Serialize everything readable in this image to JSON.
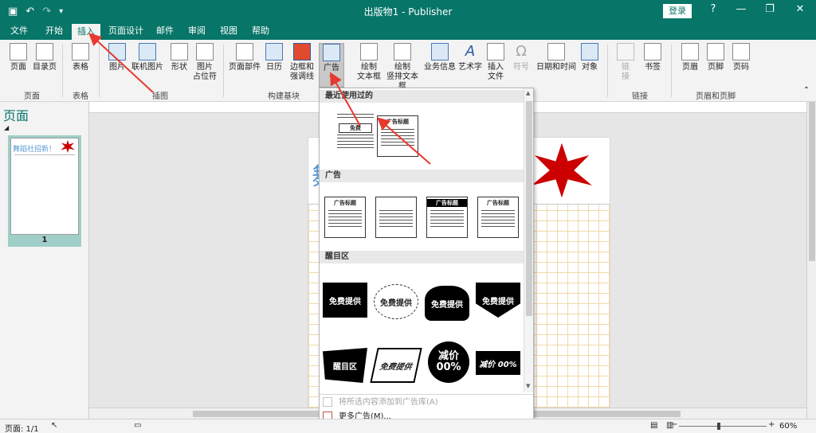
{
  "titlebar": {
    "title": "出版物1 - Publisher",
    "login": "登录",
    "help": "?",
    "qat": {
      "save_icon": "save-icon",
      "undo": "↶",
      "redo": "↷"
    }
  },
  "tabs": [
    {
      "label": "文件"
    },
    {
      "label": "开始"
    },
    {
      "label": "插入"
    },
    {
      "label": "页面设计"
    },
    {
      "label": "邮件"
    },
    {
      "label": "审阅"
    },
    {
      "label": "视图"
    },
    {
      "label": "帮助"
    }
  ],
  "ribbon": {
    "buttons": {
      "page": "页面",
      "toc": "目录页",
      "table": "表格",
      "picture": "图片",
      "online_picture": "联机图片",
      "shape": "形状",
      "placeholder": "图片\n占位符",
      "page_parts": "页面部件",
      "calendar": "日历",
      "borders": "边框和\n强调线",
      "ad": "广告",
      "draw_textbox": "绘制\n文本框",
      "draw_vtextbox": "绘制\n竖排文本框",
      "business_info": "业务信息",
      "wordart": "艺术字",
      "insert_file": "插入\n文件",
      "symbol": "符号",
      "datetime": "日期和时间",
      "object": "对象",
      "link": "链\n接",
      "bookmark": "书签",
      "header": "页眉",
      "footer": "页脚",
      "page_number": "页码"
    },
    "groups": {
      "pages": "页面",
      "tables": "表格",
      "illustrations": "插图",
      "building_blocks": "构建基块",
      "links": "链接",
      "header_footer": "页眉和页脚"
    }
  },
  "pages_pane": {
    "title": "页面",
    "thumb_text": "舞蹈社招新！",
    "page_number": "1"
  },
  "canvas": {
    "page_text": "舞"
  },
  "dropdown": {
    "sections": {
      "recent": "最近使用过的",
      "ads": "广告",
      "attention": "醒目区"
    },
    "recent_ads": [
      {
        "title": "免费"
      },
      {
        "title": "广告标题"
      }
    ],
    "ads": [
      {
        "title": "广告标题"
      },
      {
        "title": ""
      },
      {
        "title": "广告标题"
      },
      {
        "title": "广告标题"
      }
    ],
    "badges": [
      "免费提供",
      "免费提供",
      "免费提供",
      "免费提供",
      "醒目区",
      "免费提供",
      "减价\n00%",
      "减价 00%"
    ],
    "commands": {
      "add_to_gallery": "将所选内容添加到广告库(A)",
      "more_ads": "更多广告(M)..."
    }
  },
  "statusbar": {
    "page": "页面: 1/1",
    "zoom": "60%"
  },
  "colors": {
    "accent": "#077568",
    "arrow": "#e8392e",
    "starburst": "#cc0000"
  }
}
